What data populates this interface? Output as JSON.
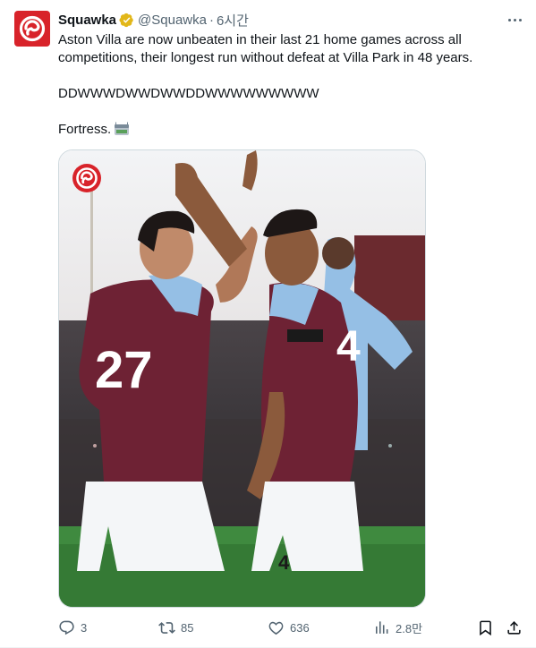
{
  "tweet": {
    "author_name": "Squawka",
    "handle": "@Squawka",
    "separator": "·",
    "time": "6시간",
    "text_line1": "Aston Villa are now unbeaten in their last 21 home games across all competitions, their longest run without defeat at Villa Park in 48 years.",
    "text_line2": "DDWWWDWWDWWDDWWWWWWWWW",
    "text_line3": "Fortress.",
    "emoji": "stadium"
  },
  "media": {
    "alt": "Aston Villa players celebrating",
    "jersey_numbers": [
      "27",
      "4"
    ]
  },
  "actions": {
    "replies": "3",
    "reposts": "85",
    "likes": "636",
    "views": "2.8만"
  },
  "colors": {
    "brand_red": "#d8232a",
    "verified_gold": "#e2b719",
    "muted": "#536471",
    "claret": "#6e2234",
    "sky_blue": "#95bfe5"
  }
}
